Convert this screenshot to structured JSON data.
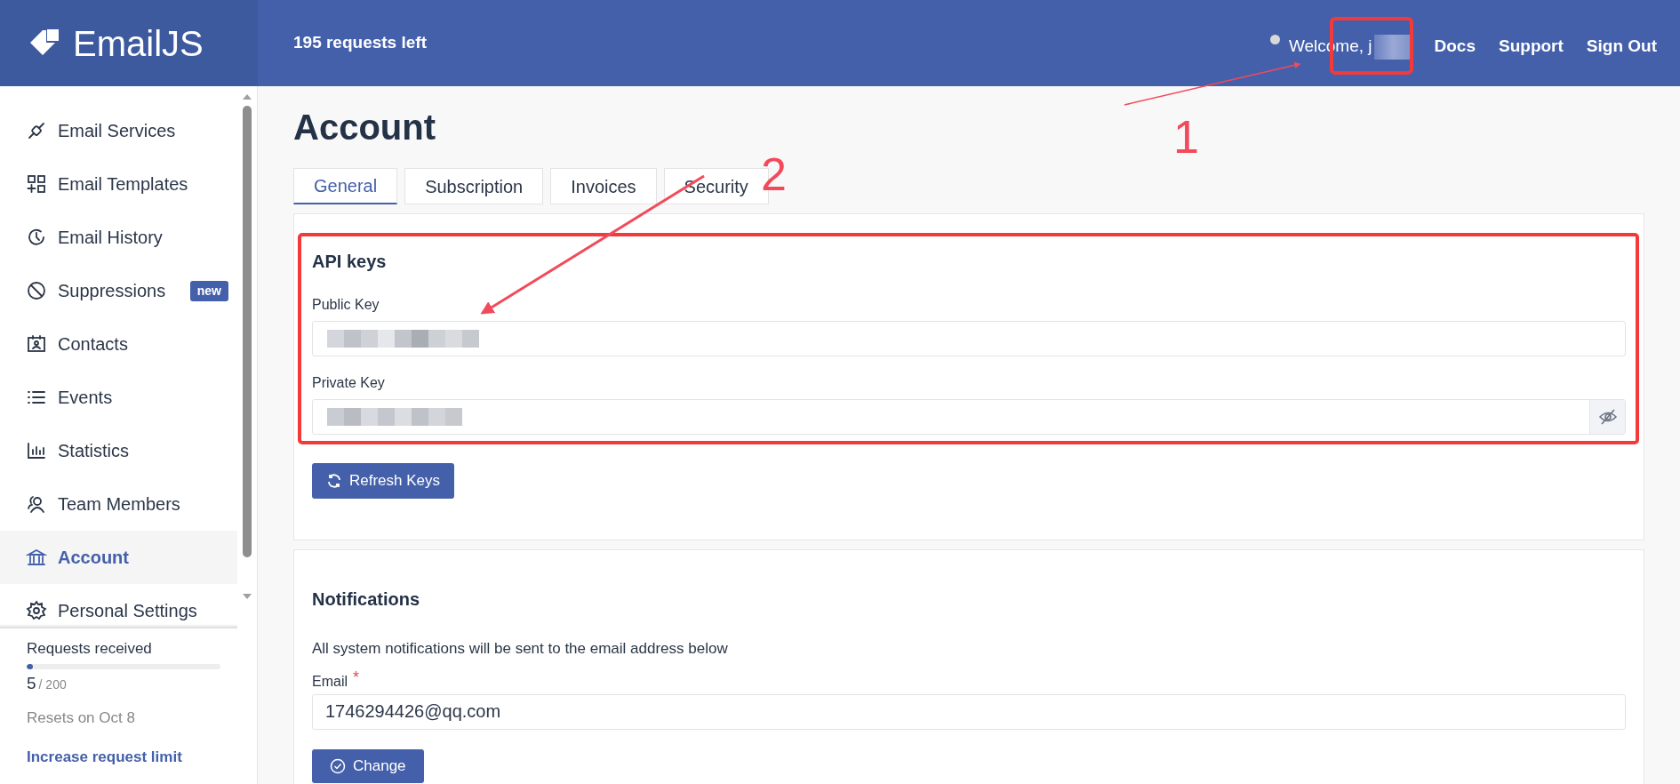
{
  "header": {
    "logo": "EmailJS",
    "requests_left": "195 requests left",
    "welcome": "Welcome, j",
    "links": [
      "Docs",
      "Support",
      "Sign Out"
    ]
  },
  "sidebar": {
    "items": [
      {
        "label": "Email Services",
        "selected": false
      },
      {
        "label": "Email Templates",
        "selected": false
      },
      {
        "label": "Email History",
        "selected": false
      },
      {
        "label": "Suppressions",
        "selected": false,
        "badge": "new"
      },
      {
        "label": "Contacts",
        "selected": false
      },
      {
        "label": "Events",
        "selected": false
      },
      {
        "label": "Statistics",
        "selected": false
      },
      {
        "label": "Team Members",
        "selected": false
      },
      {
        "label": "Account",
        "selected": true
      },
      {
        "label": "Personal Settings",
        "selected": false
      }
    ],
    "usage": {
      "label": "Requests received",
      "level": 0.025,
      "count": "5",
      "limit": "/ 200",
      "resets": "Resets on Oct 8",
      "link": "Increase request limit"
    }
  },
  "page": {
    "title": "Account",
    "tabs": [
      {
        "label": "General",
        "selected": true
      },
      {
        "label": "Subscription",
        "selected": false
      },
      {
        "label": "Invoices",
        "selected": false
      },
      {
        "label": "Security",
        "selected": false
      }
    ],
    "api_keys": {
      "heading": "API keys",
      "fields": [
        {
          "label": "Public Key",
          "kind": "plain"
        },
        {
          "label": "Private Key",
          "kind": "secret"
        }
      ],
      "button": "Refresh Keys"
    },
    "notifications": {
      "heading": "Notifications",
      "description": "All system notifications will be sent to the email address below",
      "email_label": "Email",
      "required_mark": "*",
      "email_value": "1746294426@qq.com",
      "button": "Change"
    }
  },
  "annotations": [
    "1",
    "2"
  ]
}
